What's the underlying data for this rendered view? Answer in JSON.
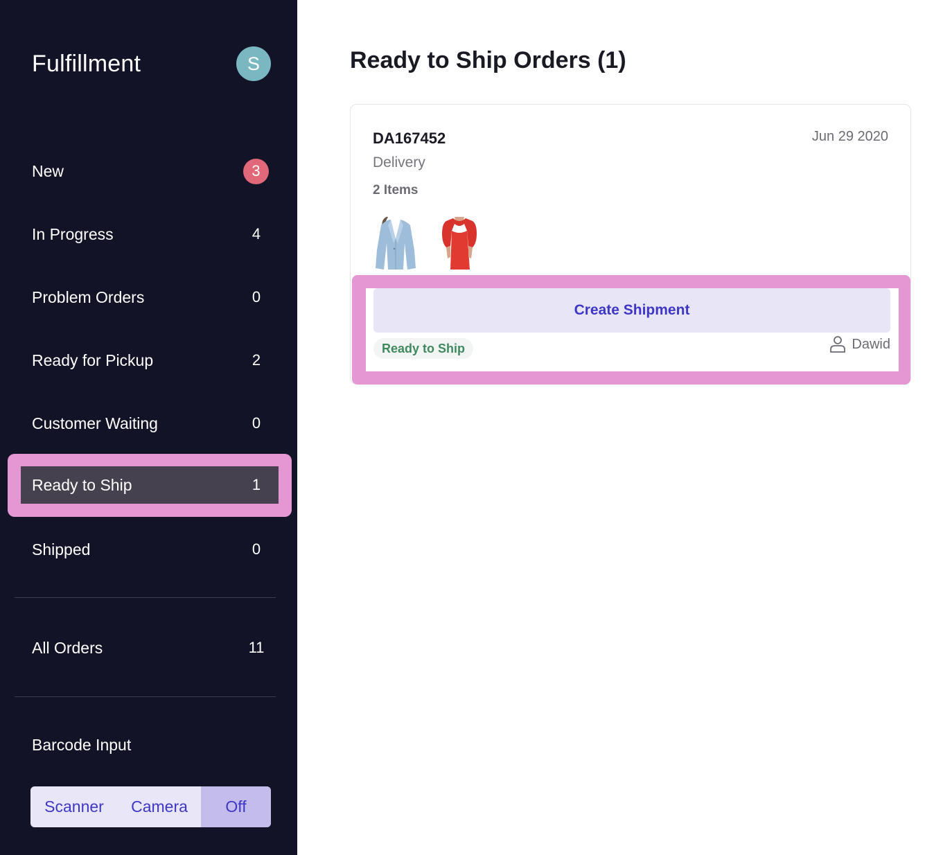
{
  "sidebar": {
    "title": "Fulfillment",
    "avatar_initial": "S",
    "nav_items": [
      {
        "label": "New",
        "count": "3",
        "badge": true
      },
      {
        "label": "In Progress",
        "count": "4"
      },
      {
        "label": "Problem Orders",
        "count": "0"
      },
      {
        "label": "Ready for Pickup",
        "count": "2"
      },
      {
        "label": "Customer Waiting",
        "count": "0"
      },
      {
        "label": "Ready to Ship",
        "count": "1",
        "active": true
      },
      {
        "label": "Shipped",
        "count": "0"
      }
    ],
    "all_orders": {
      "label": "All Orders",
      "count": "11"
    },
    "barcode": {
      "label": "Barcode Input",
      "options": [
        "Scanner",
        "Camera",
        "Off"
      ],
      "selected": "Off"
    }
  },
  "main": {
    "title": "Ready to Ship Orders (1)",
    "orders": [
      {
        "id": "DA167452",
        "date": "Jun 29 2020",
        "type": "Delivery",
        "item_count": "2 Items",
        "items": [
          {
            "image": "light blue blazer"
          },
          {
            "image": "red puff-sleeve dress"
          }
        ],
        "action_label": "Create Shipment",
        "status": "Ready to Ship",
        "assignee": "Dawid",
        "assignee_icon": "user-icon"
      }
    ]
  },
  "colors": {
    "sidebar_bg": "#131327",
    "accent": "#3d37c6",
    "badge_red": "#e06878",
    "avatar": "#79b7c1",
    "status_green": "#3f8a5d",
    "highlight": "#e597d4"
  }
}
